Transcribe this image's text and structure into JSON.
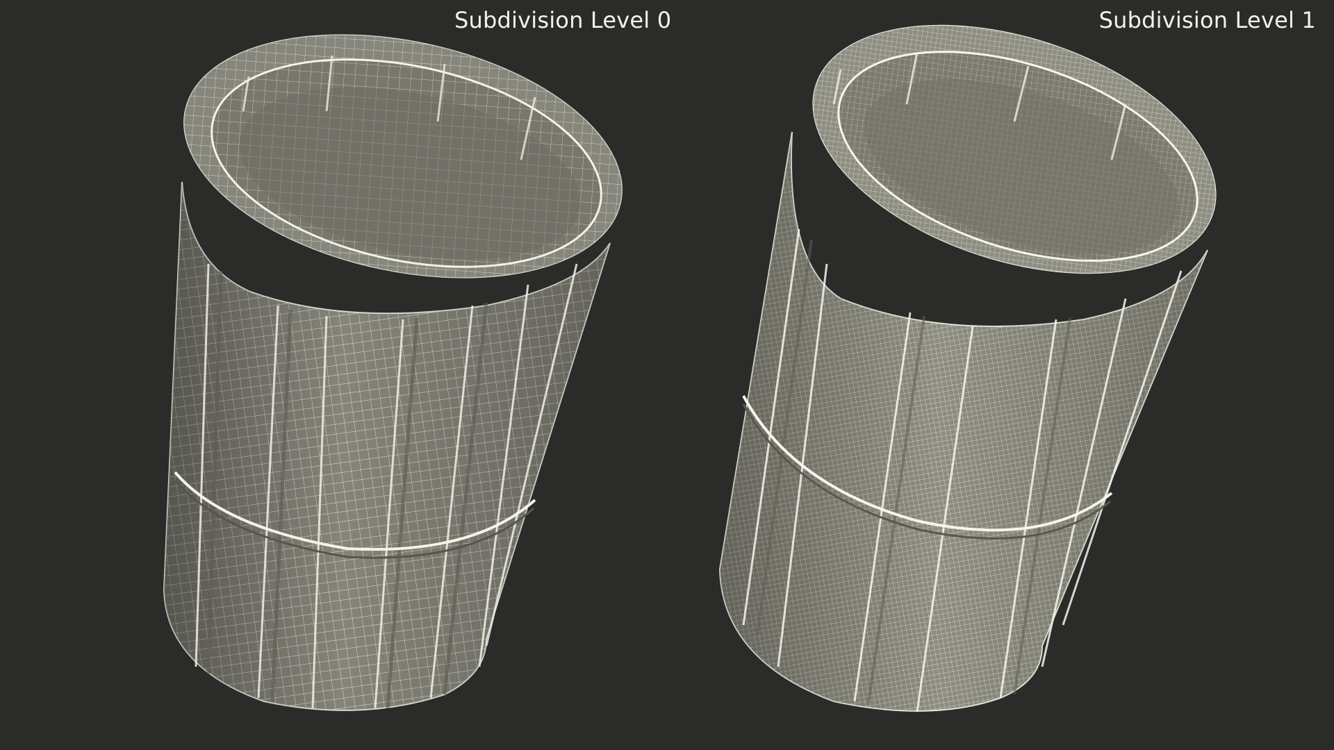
{
  "scene": {
    "background_color": "#2b2b2a",
    "mesh_color": "#8a8a7c",
    "wire_color": "#e8e8dc",
    "labels": {
      "left": "Subdivision Level 0",
      "right": "Subdivision Level 1"
    },
    "models": [
      {
        "name": "bin-subdivision-level-0",
        "wire_density": "coarse"
      },
      {
        "name": "bin-subdivision-level-1",
        "wire_density": "fine"
      }
    ]
  }
}
